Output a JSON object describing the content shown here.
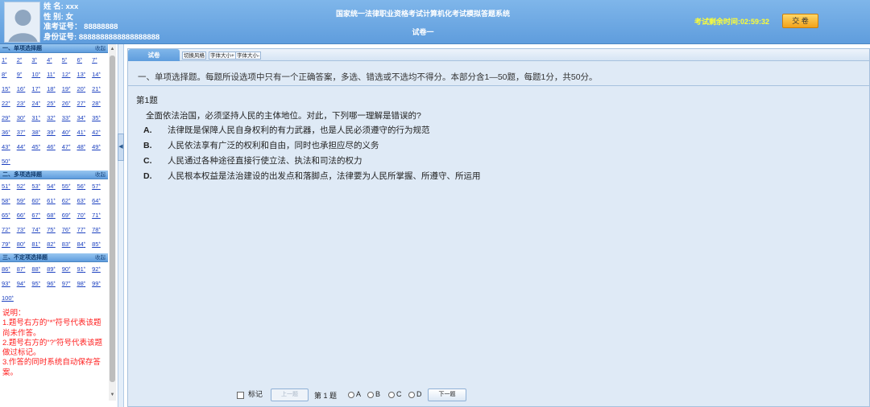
{
  "header": {
    "user": {
      "name_label": "姓  名:",
      "name_value": "xxx",
      "gender_label": "性  别:",
      "gender_value": "女",
      "ticket_label": "准考证号：",
      "ticket_value": "88888888",
      "id_label": "身份证号:",
      "id_value": "8888888888888888888"
    },
    "system_title": "国家统一法律职业资格考试计算机化考试模拟答题系统",
    "paper_title": "试卷一",
    "timer": "考试剩余时间:02:59:32",
    "submit_label": "交 卷"
  },
  "sidebar": {
    "sections": [
      {
        "title": "一、单项选择题",
        "collapse": "收起",
        "questions": [
          "1",
          "2",
          "3",
          "4",
          "5",
          "6",
          "7",
          "8",
          "9",
          "10",
          "11",
          "12",
          "13",
          "14",
          "15",
          "16",
          "17",
          "18",
          "19",
          "20",
          "21",
          "22",
          "23",
          "24",
          "25",
          "26",
          "27",
          "28",
          "29",
          "30",
          "31",
          "32",
          "33",
          "34",
          "35",
          "36",
          "37",
          "38",
          "39",
          "40",
          "41",
          "42",
          "43",
          "44",
          "45",
          "46",
          "47",
          "48",
          "49",
          "50"
        ]
      },
      {
        "title": "二、多项选择题",
        "collapse": "收起",
        "questions": [
          "51",
          "52",
          "53",
          "54",
          "55",
          "56",
          "57",
          "58",
          "59",
          "60",
          "61",
          "62",
          "63",
          "64",
          "65",
          "66",
          "67",
          "68",
          "69",
          "70",
          "71",
          "72",
          "73",
          "74",
          "75",
          "76",
          "77",
          "78",
          "79",
          "80",
          "81",
          "82",
          "83",
          "84",
          "85"
        ]
      },
      {
        "title": "三、不定项选择题",
        "collapse": "收起",
        "questions": [
          "86",
          "87",
          "88",
          "89",
          "90",
          "91",
          "92",
          "93",
          "94",
          "95",
          "96",
          "97",
          "98",
          "99",
          "100"
        ]
      }
    ],
    "unanswered_mark": "*",
    "notes": [
      "说明：",
      "1.题号右方的“*”符号代表该题尚未作答。",
      "2.题号右方的“?”符号代表该题做过标记。",
      "3.作答的同时系统自动保存答案。"
    ]
  },
  "main": {
    "tab_label": "试卷",
    "toolbar": [
      "切换风格",
      "字体大小+",
      "字体大小-"
    ],
    "instruction": "一、单项选择题。每题所设选项中只有一个正确答案，多选、错选或不选均不得分。本部分含1—50题，每题1分，共50分。",
    "question_number": "第1题",
    "question_stem": "全面依法治国，必须坚持人民的主体地位。对此，下列哪一理解是错误的?",
    "options": [
      {
        "letter": "A.",
        "text": "法律既是保障人民自身权利的有力武器，也是人民必须遵守的行为规范"
      },
      {
        "letter": "B.",
        "text": "人民依法享有广泛的权利和自由，同时也承担应尽的义务"
      },
      {
        "letter": "C.",
        "text": "人民通过各种途径直接行使立法、执法和司法的权力"
      },
      {
        "letter": "D.",
        "text": "人民根本权益是法治建设的出发点和落脚点，法律要为人民所掌握、所遵守、所运用"
      }
    ]
  },
  "bottom": {
    "mark_label": "标记",
    "prev_label": "上一题",
    "current": "第 1 题",
    "choices": [
      "A",
      "B",
      "C",
      "D"
    ],
    "next_label": "下一题"
  }
}
